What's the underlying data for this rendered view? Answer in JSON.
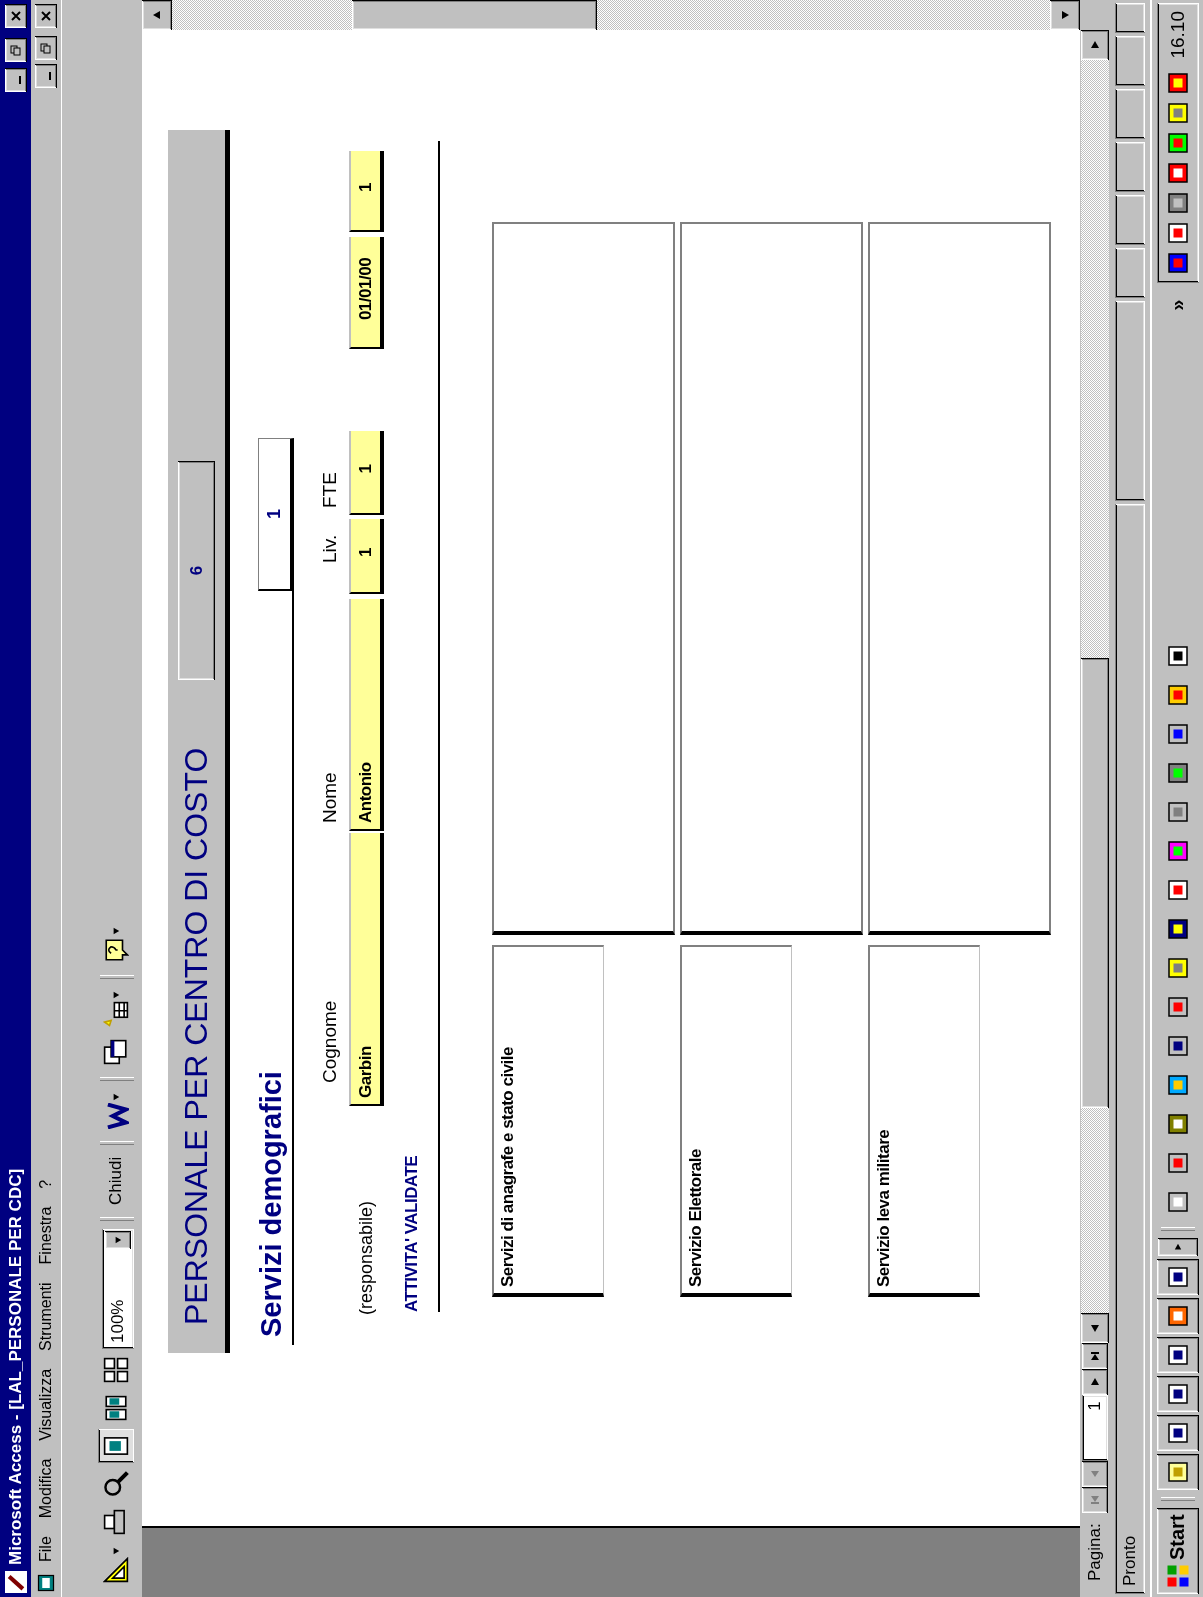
{
  "window": {
    "title": "Microsoft Access - [LAL_PERSONALE PER CDC]"
  },
  "menu": [
    "File",
    "Modifica",
    "Visualizza",
    "Strumenti",
    "Finestra",
    "?"
  ],
  "toolbar": {
    "zoom": "100%",
    "close_label": "Chiudi"
  },
  "report": {
    "title": "PERSONALE PER CENTRO DI COSTO",
    "count": "6",
    "department": "Servizi demografici",
    "department_code": "1",
    "responsible_label": "(responsabile)",
    "columns": [
      "Cognome",
      "Nome",
      "Liv.",
      "FTE"
    ],
    "responsible": {
      "surname": "Garbin",
      "name": "Antonio",
      "level": "1",
      "fte": "1",
      "date": "01/01/00",
      "column_6": "1"
    },
    "section_title": "ATTIVITA' VALIDATE",
    "activities": [
      {
        "name": "Servizi di anagrafe e stato civile"
      },
      {
        "name": "Servizio Elettorale"
      },
      {
        "name": "Servizio leva militare"
      }
    ]
  },
  "navigator": {
    "label": "Pagina:",
    "page": "1"
  },
  "status_bar": "Pronto",
  "taskbar": {
    "start": "Start",
    "chevron": "»",
    "clock": "16.10"
  }
}
